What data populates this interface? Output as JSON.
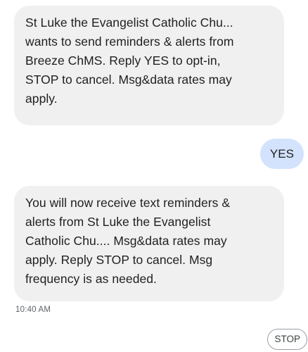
{
  "messages": [
    {
      "direction": "incoming",
      "text": "St Luke the Evangelist Catholic Chu...\nwants to send reminders & alerts from\nBreeze ChMS. Reply YES to opt-in,\nSTOP to cancel. Msg&data rates may\napply."
    },
    {
      "direction": "outgoing",
      "text": "YES"
    },
    {
      "direction": "incoming",
      "text": "You will now receive text reminders &\nalerts from St Luke the Evangelist\nCatholic Chu.... Msg&data rates may\napply. Reply STOP to cancel. Msg\nfrequency is as needed.",
      "timestamp": "10:40 AM"
    }
  ],
  "suggested_reply": "STOP",
  "colors": {
    "incoming_bubble": "#f0f0f0",
    "outgoing_bubble": "#d3e3fd",
    "timestamp_text": "#5f6368",
    "chip_border": "#9aa0a6"
  }
}
